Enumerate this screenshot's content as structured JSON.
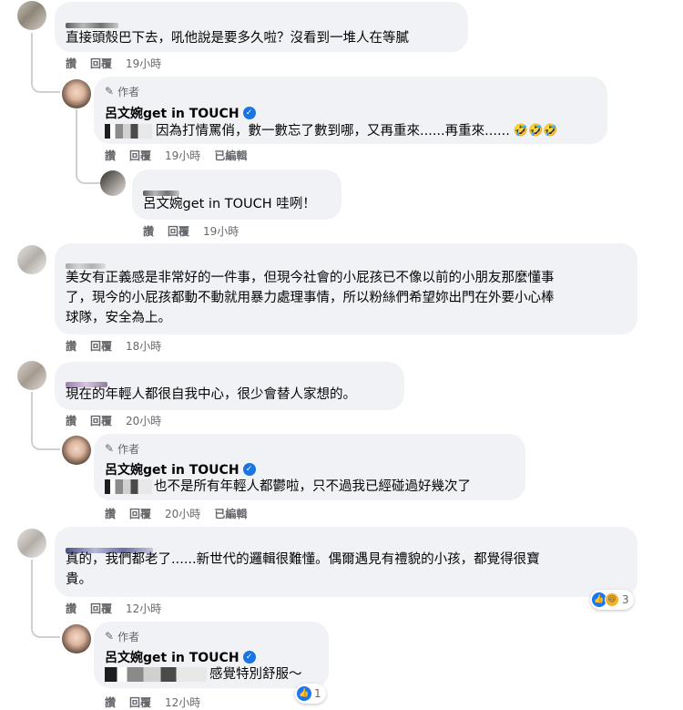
{
  "actions": {
    "like": "讚",
    "reply": "回覆",
    "edited": "已編輯"
  },
  "author_badge": "作者",
  "page_name": "呂文婉get in TOUCH",
  "comments": [
    {
      "text": "直接頭殼巴下去，吼他說是要多久啦？沒看到一堆人在等膩",
      "time": "19小時"
    },
    {
      "text": "因為打情罵俏，數一數忘了數到哪，又再重來......再重來......",
      "emojis": "🤣🤣🤣",
      "time": "19小時"
    },
    {
      "text": "呂文婉get in TOUCH 哇咧！",
      "time": "19小時"
    },
    {
      "lines": [
        "美女有正義感是非常好的一件事，但現今社會的小屁孩已不像以前的小朋友那麼懂事",
        "了，現今的小屁孩都動不動就用暴力處理事情，所以粉絲們希望妳出門在外要小心棒",
        "球隊，安全為上。"
      ],
      "time": "18小時"
    },
    {
      "text": "現在的年輕人都很自我中心，很少會替人家想的。",
      "time": "20小時"
    },
    {
      "text": "也不是所有年輕人都鬱啦，只不過我已經碰過好幾次了",
      "time": "20小時"
    },
    {
      "lines": [
        "真的，我們都老了......新世代的邏輯很難懂。偶爾遇見有禮貌的小孩，都覺得很寶",
        "貴。"
      ],
      "time": "12小時",
      "reactions": "3"
    },
    {
      "text": "感覺特別舒服～",
      "time": "12小時",
      "reactions": "1"
    }
  ]
}
